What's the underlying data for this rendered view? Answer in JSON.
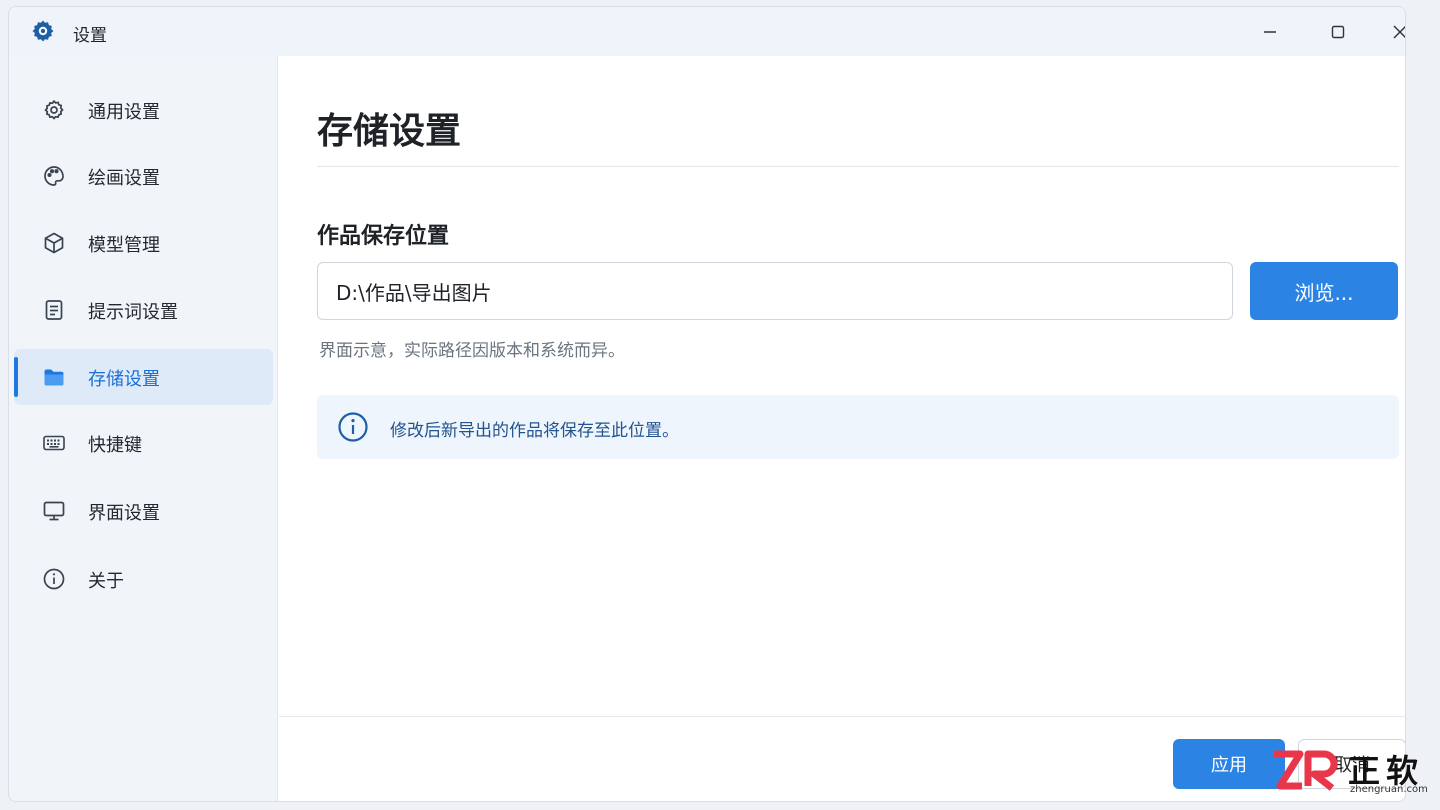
{
  "window": {
    "title": "设置"
  },
  "sidebar": {
    "items": [
      {
        "label": "通用设置",
        "icon": "gear-icon"
      },
      {
        "label": "绘画设置",
        "icon": "palette-icon"
      },
      {
        "label": "模型管理",
        "icon": "cube-icon"
      },
      {
        "label": "提示词设置",
        "icon": "document-icon"
      },
      {
        "label": "存储设置",
        "icon": "folder-icon",
        "active": true
      },
      {
        "label": "快捷键",
        "icon": "keyboard-icon"
      },
      {
        "label": "界面设置",
        "icon": "monitor-icon"
      },
      {
        "label": "关于",
        "icon": "info-icon"
      }
    ]
  },
  "main": {
    "title": "存储设置",
    "section_label": "作品保存位置",
    "path_value": "D:\\作品\\导出图片",
    "browse_label": "浏览...",
    "hint": "界面示意，实际路径因版本和系统而异。",
    "info_text": "修改后新导出的作品将保存至此位置。"
  },
  "footer": {
    "apply_label": "应用",
    "cancel_label": "取消"
  },
  "watermark": {
    "brand_cn": "正软",
    "url": "zhengruan.com"
  },
  "colors": {
    "accent": "#2b84e4",
    "active_bg": "#dfeaf8",
    "sidebar_bg": "#f1f5fa",
    "info_bg": "#eef5fd",
    "watermark_red": "#e8364a"
  }
}
